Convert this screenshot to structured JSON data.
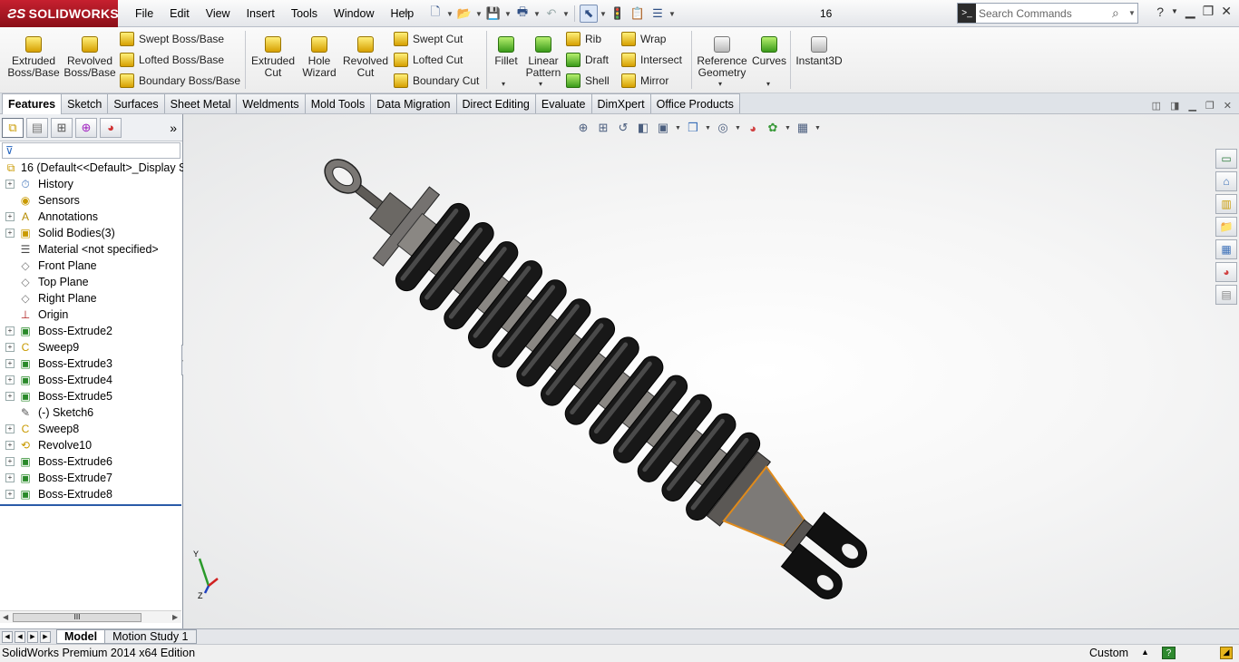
{
  "app": {
    "brand": "SOLIDWORKS",
    "brand_prefix": "3S",
    "doc_title": "16"
  },
  "menu": [
    "File",
    "Edit",
    "View",
    "Insert",
    "Tools",
    "Window",
    "Help"
  ],
  "search": {
    "placeholder": "Search Commands"
  },
  "commands": {
    "extruded_boss": "Extruded Boss/Base",
    "revolved_boss": "Revolved Boss/Base",
    "swept_boss": "Swept Boss/Base",
    "lofted_boss": "Lofted Boss/Base",
    "boundary_boss": "Boundary Boss/Base",
    "extruded_cut": "Extruded Cut",
    "hole_wizard": "Hole Wizard",
    "revolved_cut": "Revolved Cut",
    "swept_cut": "Swept Cut",
    "lofted_cut": "Lofted Cut",
    "boundary_cut": "Boundary Cut",
    "fillet": "Fillet",
    "linear_pattern": "Linear Pattern",
    "rib": "Rib",
    "draft": "Draft",
    "shell": "Shell",
    "wrap": "Wrap",
    "intersect": "Intersect",
    "mirror": "Mirror",
    "reference_geometry": "Reference Geometry",
    "curves": "Curves",
    "instant3d": "Instant3D"
  },
  "tabs": [
    "Features",
    "Sketch",
    "Surfaces",
    "Sheet Metal",
    "Weldments",
    "Mold Tools",
    "Data Migration",
    "Direct Editing",
    "Evaluate",
    "DimXpert",
    "Office Products"
  ],
  "tree": {
    "root": "16  (Default<<Default>_Display St",
    "items": [
      {
        "label": "History",
        "icon": "history-icon",
        "exp": true
      },
      {
        "label": "Sensors",
        "icon": "sensor-icon",
        "exp": false
      },
      {
        "label": "Annotations",
        "icon": "annotation-icon",
        "exp": true
      },
      {
        "label": "Solid Bodies(3)",
        "icon": "solid-bodies-icon",
        "exp": true
      },
      {
        "label": "Material <not specified>",
        "icon": "material-icon",
        "exp": false
      },
      {
        "label": "Front Plane",
        "icon": "plane-icon",
        "exp": false
      },
      {
        "label": "Top Plane",
        "icon": "plane-icon",
        "exp": false
      },
      {
        "label": "Right Plane",
        "icon": "plane-icon",
        "exp": false
      },
      {
        "label": "Origin",
        "icon": "origin-icon",
        "exp": false
      },
      {
        "label": "Boss-Extrude2",
        "icon": "extrude-icon",
        "exp": true
      },
      {
        "label": "Sweep9",
        "icon": "sweep-icon",
        "exp": true
      },
      {
        "label": "Boss-Extrude3",
        "icon": "extrude-icon",
        "exp": true
      },
      {
        "label": "Boss-Extrude4",
        "icon": "extrude-icon",
        "exp": true
      },
      {
        "label": "Boss-Extrude5",
        "icon": "extrude-icon",
        "exp": true
      },
      {
        "label": "(-) Sketch6",
        "icon": "sketch-icon",
        "exp": false
      },
      {
        "label": "Sweep8",
        "icon": "sweep-icon",
        "exp": true
      },
      {
        "label": "Revolve10",
        "icon": "revolve-icon",
        "exp": true
      },
      {
        "label": "Boss-Extrude6",
        "icon": "extrude-icon",
        "exp": true
      },
      {
        "label": "Boss-Extrude7",
        "icon": "extrude-icon",
        "exp": true
      },
      {
        "label": "Boss-Extrude8",
        "icon": "extrude-icon",
        "exp": true
      }
    ]
  },
  "triad": {
    "y": "Y",
    "z": "Z"
  },
  "bottom_tabs": [
    "Model",
    "Motion Study 1"
  ],
  "status": {
    "text": "SolidWorks Premium 2014 x64 Edition",
    "units": "Custom"
  },
  "colors": {
    "brand_red": "#b01c28",
    "accent_blue": "#2a5ba8",
    "spring": "#151515",
    "body": "#6f6c68",
    "highlight": "#e08a1a"
  }
}
